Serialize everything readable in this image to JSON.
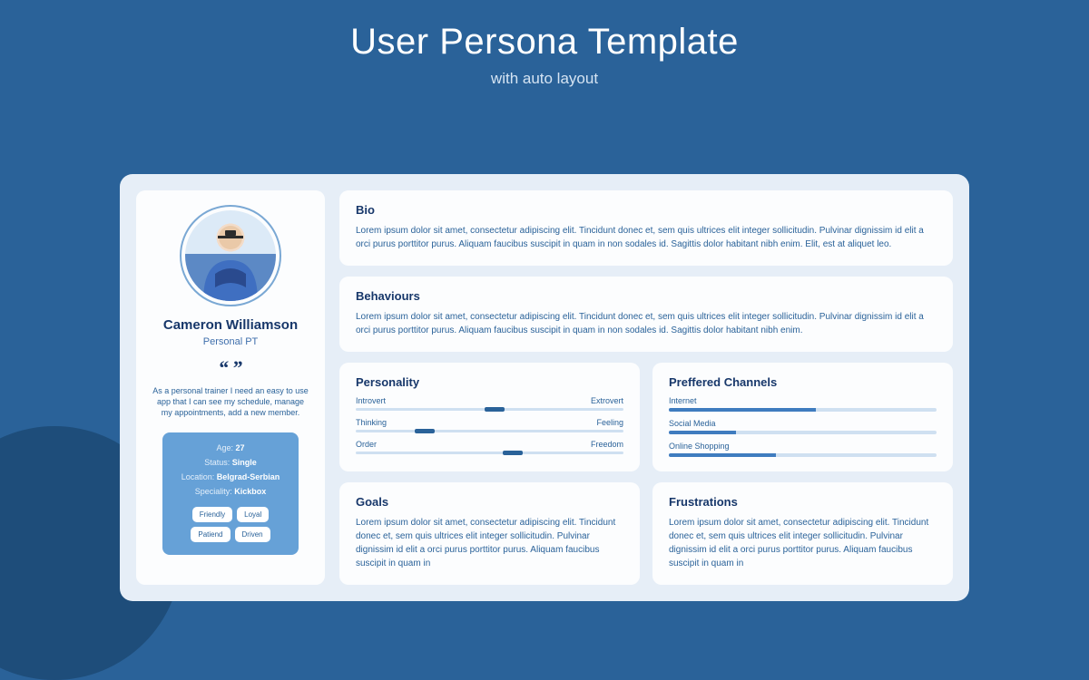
{
  "header": {
    "title": "User Persona Template",
    "subtitle": "with auto layout"
  },
  "persona": {
    "name": "Cameron Williamson",
    "role": "Personal PT",
    "quote": "As a personal trainer I need an easy to use app that I can see my schedule, manage my appointments, add a new member.",
    "info": {
      "age_label": "Age:",
      "age_value": "27",
      "status_label": "Status:",
      "status_value": "Single",
      "location_label": "Location:",
      "location_value": "Belgrad-Serbian",
      "speciality_label": "Speciality:",
      "speciality_value": "Kickbox"
    },
    "chips": [
      "Friendly",
      "Loyal",
      "Patiend",
      "Driven"
    ]
  },
  "sections": {
    "bio": {
      "title": "Bio",
      "body": "Lorem ipsum dolor sit amet, consectetur adipiscing elit. Tincidunt donec et, sem quis ultrices elit integer sollicitudin. Pulvinar dignissim id elit a orci purus porttitor purus. Aliquam faucibus suscipit in quam in non sodales id. Sagittis dolor habitant nibh enim. Elit, est at aliquet leo."
    },
    "behaviours": {
      "title": "Behaviours",
      "body": "Lorem ipsum dolor sit amet, consectetur adipiscing elit. Tincidunt donec et, sem quis ultrices elit integer sollicitudin. Pulvinar dignissim id elit a orci purus porttitor purus. Aliquam faucibus suscipit in quam in non sodales id. Sagittis dolor habitant nibh enim."
    },
    "personality": {
      "title": "Personality",
      "traits": [
        {
          "left": "Introvert",
          "right": "Extrovert",
          "pos": 48
        },
        {
          "left": "Thinking",
          "right": "Feeling",
          "pos": 22
        },
        {
          "left": "Order",
          "right": "Freedom",
          "pos": 55
        }
      ]
    },
    "channels": {
      "title": "Preffered Channels",
      "items": [
        {
          "label": "Internet",
          "pct": 55
        },
        {
          "label": "Social Media",
          "pct": 25
        },
        {
          "label": "Online Shopping",
          "pct": 40
        }
      ]
    },
    "goals": {
      "title": "Goals",
      "body": "Lorem ipsum dolor sit amet, consectetur adipiscing elit. Tincidunt donec et, sem quis ultrices elit integer sollicitudin. Pulvinar dignissim id elit a orci purus porttitor purus. Aliquam faucibus suscipit in quam in"
    },
    "frustrations": {
      "title": "Frustrations",
      "body": "Lorem ipsum dolor sit amet, consectetur adipiscing elit. Tincidunt donec et, sem quis ultrices elit integer sollicitudin. Pulvinar dignissim id elit a orci purus porttitor purus. Aliquam faucibus suscipit in quam in"
    }
  }
}
